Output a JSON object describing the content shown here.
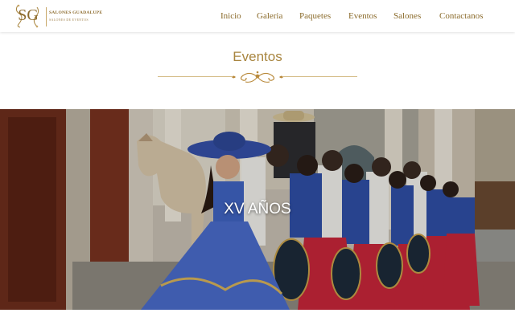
{
  "header": {
    "logo": {
      "monogram": "SG",
      "name": "SALONES GUADALUPE",
      "tagline": "SALONES DE EVENTOS"
    },
    "nav": [
      {
        "label": "Inicio"
      },
      {
        "label": "Galeria"
      },
      {
        "label": "Paquetes"
      },
      {
        "label": "Eventos"
      },
      {
        "label": "Salones"
      },
      {
        "label": "Contactanos"
      }
    ]
  },
  "section": {
    "title": "Eventos"
  },
  "hero": {
    "caption": "XV AÑOS",
    "image_icon": "quinceanera-mariachi-photo"
  },
  "colors": {
    "brand_gold": "#a8853f",
    "nav_text": "#8a6a2a",
    "caption": "#ffffff"
  }
}
